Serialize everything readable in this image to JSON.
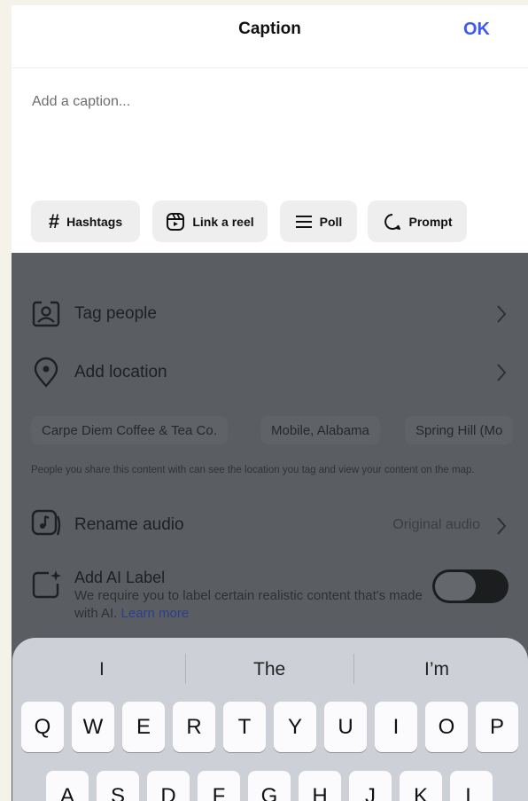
{
  "header": {
    "title": "Caption",
    "ok_label": "OK"
  },
  "caption": {
    "placeholder": "Add a caption..."
  },
  "chips": [
    {
      "label": "Hashtags",
      "icon": "hash-icon"
    },
    {
      "label": "Link a reel",
      "icon": "reel-icon"
    },
    {
      "label": "Poll",
      "icon": "poll-icon"
    },
    {
      "label": "Prompt",
      "icon": "prompt-icon"
    }
  ],
  "options": {
    "tag_people": "Tag people",
    "add_location": "Add location",
    "location_suggestions": [
      "Carpe Diem Coffee & Tea Co.",
      "Mobile, Alabama",
      "Spring Hill (Mo"
    ],
    "location_note": "People you share this content with can see the location you tag and view your content on the map.",
    "rename_audio": "Rename audio",
    "audio_value": "Original audio",
    "ai_label": "Add AI Label",
    "ai_description": "We require you to label certain realistic content that's made with AI.",
    "learn_more": "Learn more",
    "ai_label_enabled": false
  },
  "keyboard": {
    "suggestions": [
      "I",
      "The",
      "I’m"
    ],
    "row1": [
      "Q",
      "W",
      "E",
      "R",
      "T",
      "Y",
      "U",
      "I",
      "O",
      "P"
    ],
    "row2": [
      "A",
      "S",
      "D",
      "F",
      "G",
      "H",
      "J",
      "K",
      "L"
    ]
  },
  "colors": {
    "accent": "#3e5bf0",
    "dim_overlay": "#5a5e62",
    "keyboard_bg": "#cdd1d7"
  }
}
